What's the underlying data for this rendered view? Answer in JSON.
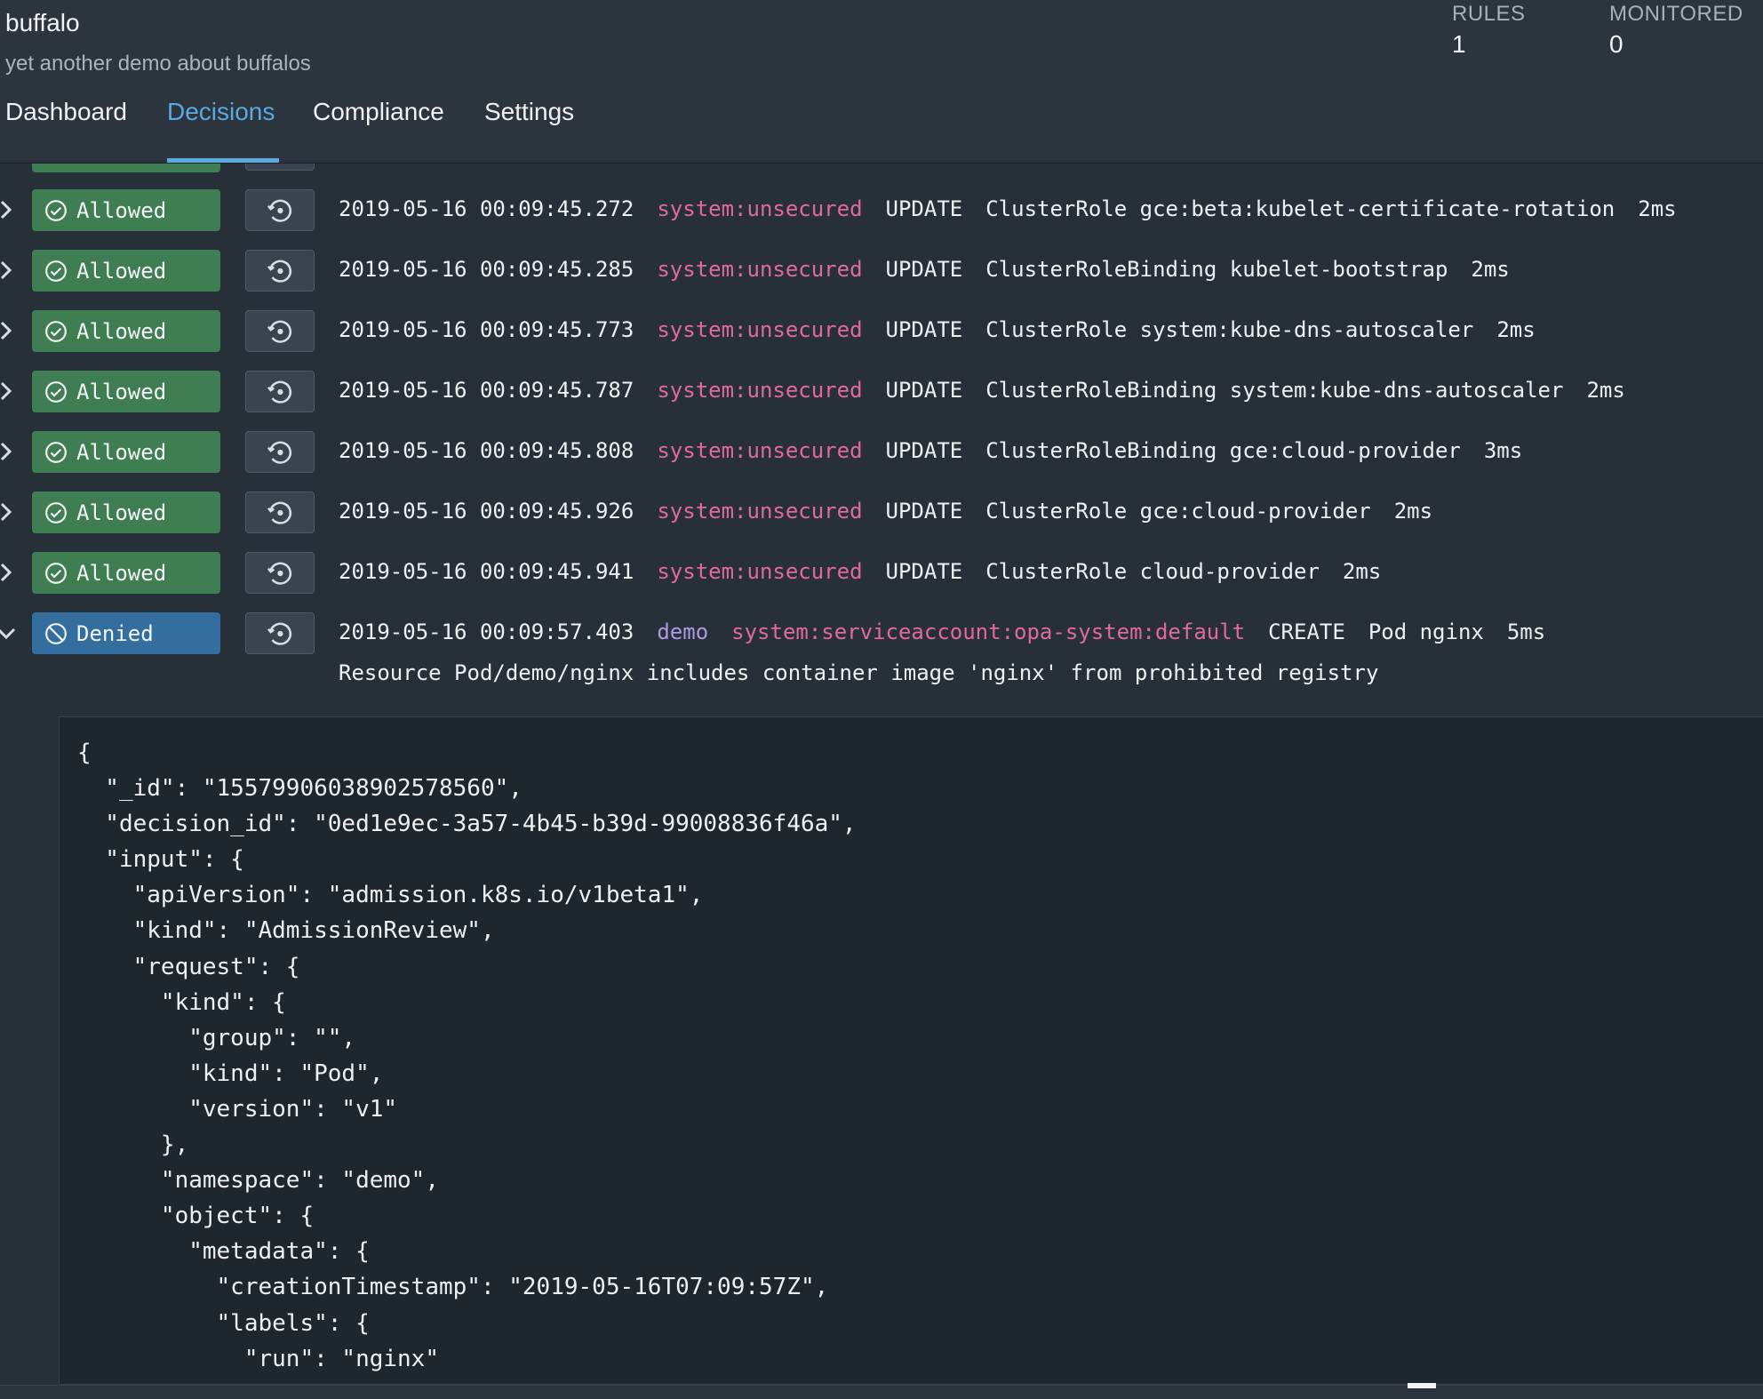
{
  "app": {
    "title": "buffalo",
    "subtitle": "yet another demo about buffalos"
  },
  "stats": {
    "rules_label": "RULES",
    "rules_value": "1",
    "monitored_label": "MONITORED",
    "monitored_value": "0"
  },
  "tabs": [
    {
      "label": "Dashboard",
      "active": false
    },
    {
      "label": "Decisions",
      "active": true
    },
    {
      "label": "Compliance",
      "active": false
    },
    {
      "label": "Settings",
      "active": false
    }
  ],
  "colors": {
    "allowed": "#3f7d52",
    "denied": "#336e9f",
    "accent": "#5aa9e0",
    "user": "#e06a9a",
    "namespace": "#a99be6"
  },
  "decisions": [
    {
      "status": "Allowed",
      "timestamp": "2019-05-16 00:09:45.272",
      "user": "system:unsecured",
      "operation": "UPDATE",
      "resource": "ClusterRole gce:beta:kubelet-certificate-rotation",
      "duration": "2ms",
      "expanded": false
    },
    {
      "status": "Allowed",
      "timestamp": "2019-05-16 00:09:45.285",
      "user": "system:unsecured",
      "operation": "UPDATE",
      "resource": "ClusterRoleBinding kubelet-bootstrap",
      "duration": "2ms",
      "expanded": false
    },
    {
      "status": "Allowed",
      "timestamp": "2019-05-16 00:09:45.773",
      "user": "system:unsecured",
      "operation": "UPDATE",
      "resource": "ClusterRole system:kube-dns-autoscaler",
      "duration": "2ms",
      "expanded": false
    },
    {
      "status": "Allowed",
      "timestamp": "2019-05-16 00:09:45.787",
      "user": "system:unsecured",
      "operation": "UPDATE",
      "resource": "ClusterRoleBinding system:kube-dns-autoscaler",
      "duration": "2ms",
      "expanded": false
    },
    {
      "status": "Allowed",
      "timestamp": "2019-05-16 00:09:45.808",
      "user": "system:unsecured",
      "operation": "UPDATE",
      "resource": "ClusterRoleBinding gce:cloud-provider",
      "duration": "3ms",
      "expanded": false
    },
    {
      "status": "Allowed",
      "timestamp": "2019-05-16 00:09:45.926",
      "user": "system:unsecured",
      "operation": "UPDATE",
      "resource": "ClusterRole gce:cloud-provider",
      "duration": "2ms",
      "expanded": false
    },
    {
      "status": "Allowed",
      "timestamp": "2019-05-16 00:09:45.941",
      "user": "system:unsecured",
      "operation": "UPDATE",
      "resource": "ClusterRole cloud-provider",
      "duration": "2ms",
      "expanded": false
    },
    {
      "status": "Denied",
      "timestamp": "2019-05-16 00:09:57.403",
      "namespace": "demo",
      "user": "system:serviceaccount:opa-system:default",
      "operation": "CREATE",
      "resource": "Pod nginx",
      "duration": "5ms",
      "expanded": true
    }
  ],
  "denied_reason": "Resource Pod/demo/nginx includes container image 'nginx' from prohibited registry",
  "json_lines": [
    "{",
    "  \"_id\": \"15579906038902578560\",",
    "  \"decision_id\": \"0ed1e9ec-3a57-4b45-b39d-99008836f46a\",",
    "  \"input\": {",
    "    \"apiVersion\": \"admission.k8s.io/v1beta1\",",
    "    \"kind\": \"AdmissionReview\",",
    "    \"request\": {",
    "      \"kind\": {",
    "        \"group\": \"\",",
    "        \"kind\": \"Pod\",",
    "        \"version\": \"v1\"",
    "      },",
    "      \"namespace\": \"demo\",",
    "      \"object\": {",
    "        \"metadata\": {",
    "          \"creationTimestamp\": \"2019-05-16T07:09:57Z\",",
    "          \"labels\": {",
    "            \"run\": \"nginx\"",
    "          }"
  ]
}
